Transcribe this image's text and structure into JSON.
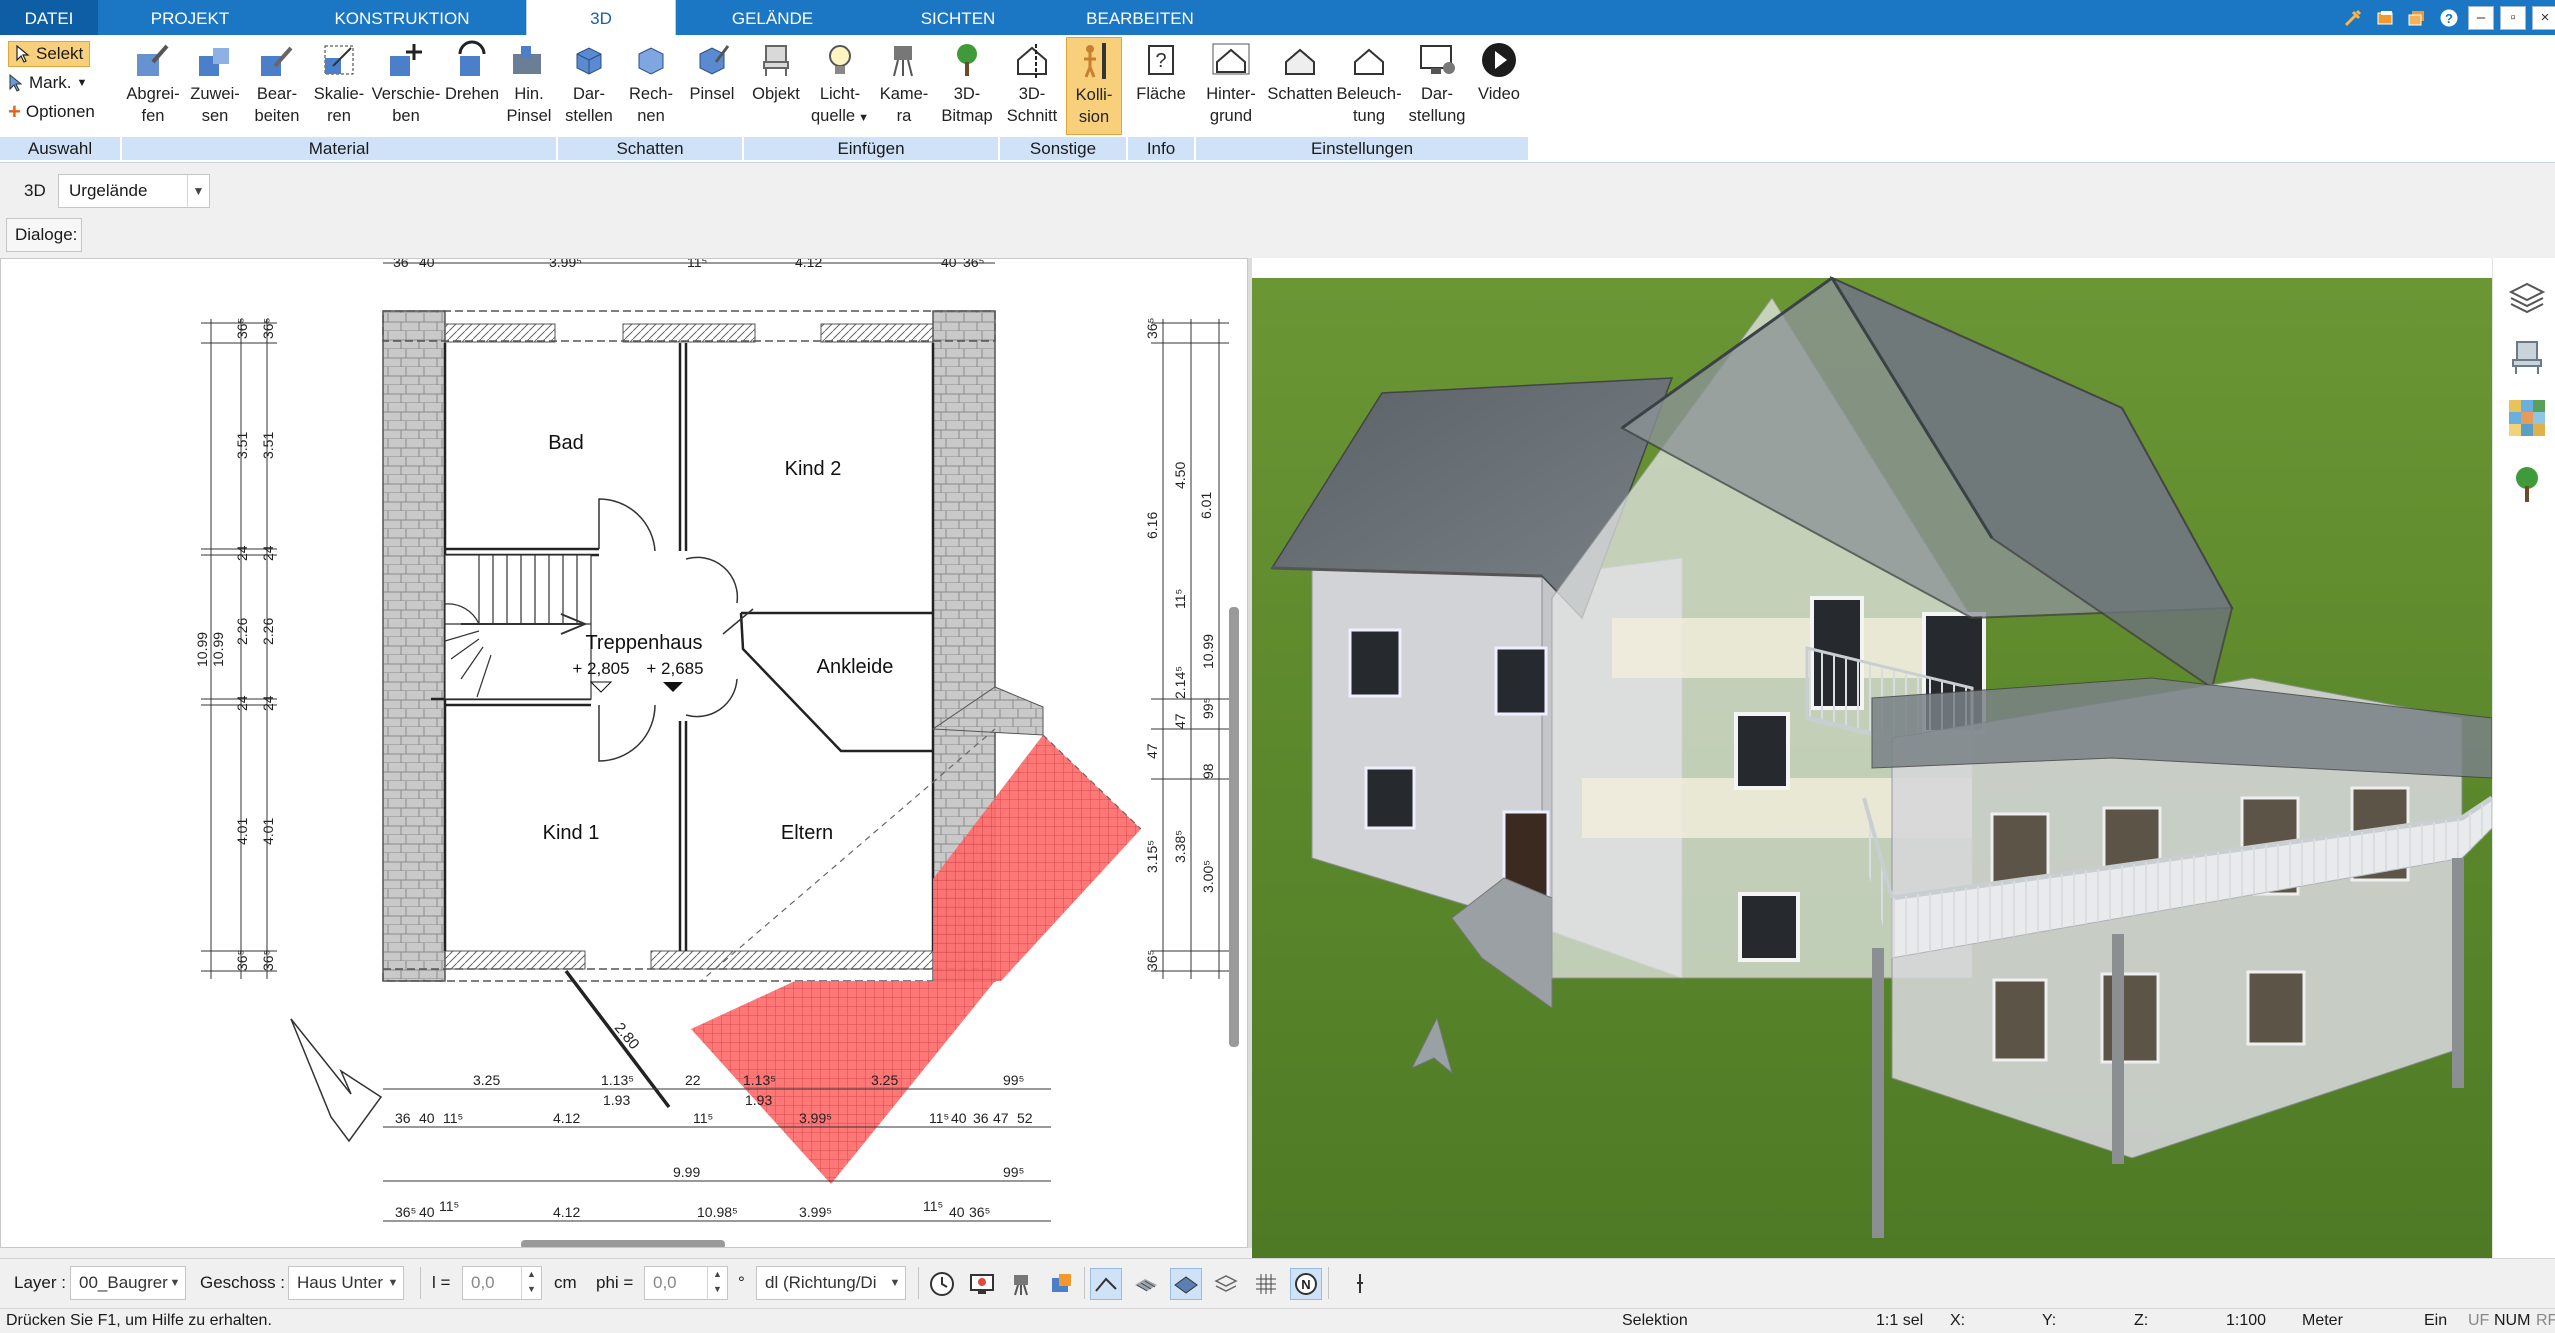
{
  "tabs": [
    {
      "label": "DATEI"
    },
    {
      "label": "PROJEKT"
    },
    {
      "label": "KONSTRUKTION"
    },
    {
      "label": "3D"
    },
    {
      "label": "GELÄNDE"
    },
    {
      "label": "SICHTEN"
    },
    {
      "label": "BEARBEITEN"
    }
  ],
  "ribbon": {
    "auswahl": {
      "label": "Auswahl",
      "selekt": "Selekt",
      "mark": "Mark.",
      "optionen": "Optionen"
    },
    "material": {
      "label": "Material",
      "buttons": [
        {
          "l1": "Abgrei-",
          "l2": "fen"
        },
        {
          "l1": "Zuwei-",
          "l2": "sen"
        },
        {
          "l1": "Bear-",
          "l2": "beiten"
        },
        {
          "l1": "Skalie-",
          "l2": "ren"
        },
        {
          "l1": "Verschie-",
          "l2": "ben"
        },
        {
          "l1": "Drehen",
          "l2": ""
        },
        {
          "l1": "Hin.",
          "l2": "Pinsel"
        }
      ]
    },
    "schatten": {
      "label": "Schatten",
      "buttons": [
        {
          "l1": "Dar-",
          "l2": "stellen"
        },
        {
          "l1": "Rech-",
          "l2": "nen"
        },
        {
          "l1": "Pinsel",
          "l2": ""
        }
      ]
    },
    "einfuegen": {
      "label": "Einfügen",
      "buttons": [
        {
          "l1": "Objekt",
          "l2": ""
        },
        {
          "l1": "Licht-",
          "l2": "quelle"
        },
        {
          "l1": "Kame-",
          "l2": "ra"
        },
        {
          "l1": "3D-",
          "l2": "Bitmap"
        }
      ]
    },
    "sonstige": {
      "label": "Sonstige",
      "buttons": [
        {
          "l1": "3D-",
          "l2": "Schnitt"
        },
        {
          "l1": "Kolli-",
          "l2": "sion"
        }
      ]
    },
    "info": {
      "label": "Info",
      "buttons": [
        {
          "l1": "Fläche",
          "l2": ""
        }
      ]
    },
    "einstellungen": {
      "label": "Einstellungen",
      "buttons": [
        {
          "l1": "Hinter-",
          "l2": "grund"
        },
        {
          "l1": "Schatten",
          "l2": ""
        },
        {
          "l1": "Beleuch-",
          "l2": "tung"
        },
        {
          "l1": "Dar-",
          "l2": "stellung"
        },
        {
          "l1": "Video",
          "l2": ""
        }
      ]
    }
  },
  "toolbar": {
    "mode_label": "3D",
    "terrain_select": "Urgelände",
    "dialoge_label": "Dialoge:"
  },
  "plan": {
    "rooms": {
      "bad": "Bad",
      "kind2": "Kind 2",
      "treppenhaus": "Treppenhaus",
      "level1": "+ 2,805",
      "level2": "+ 2,685",
      "ankleide": "Ankleide",
      "kind1": "Kind 1",
      "eltern": "Eltern"
    },
    "dims_top": [
      "36",
      "40",
      "3.99⁵",
      "11⁵",
      "4.12",
      "40",
      "36⁵"
    ],
    "dims_left_outer": [
      "36⁵",
      "3.51",
      "24",
      "2.26",
      "24",
      "4.01",
      "36⁵"
    ],
    "dims_left_inner": [
      "36⁵",
      "3.51",
      "24",
      "2.26",
      "24",
      "4.01",
      "36⁵"
    ],
    "dims_left_total": [
      "10.99",
      "10.99"
    ],
    "dims_right": [
      "36⁵",
      "6.16",
      "4.50",
      "6.01",
      "11⁵",
      "2.14⁵",
      "10.99",
      "99⁵",
      "47",
      "47",
      "98",
      "3.15⁵",
      "3.38⁵",
      "3.00⁵",
      "36⁵"
    ],
    "dims_bottom_row1": [
      "3.25",
      "1.13⁵",
      "1.93",
      "22",
      "1.13⁵",
      "1.93",
      "3.25",
      "99⁵"
    ],
    "dims_bottom_row2": [
      "36",
      "40",
      "11⁵",
      "4.12",
      "11⁵",
      "3.99⁵",
      "11⁵",
      "40",
      "36",
      "47",
      "52"
    ],
    "dims_bottom_row3": [
      "9.99",
      "99⁵"
    ],
    "dims_bottom_row4": [
      "36⁵",
      "40",
      "11⁵",
      "4.12",
      "10.98⁵",
      "3.99⁵",
      "11⁵",
      "40",
      "36⁵"
    ],
    "diag_dim": "2.80"
  },
  "bottombar": {
    "layer_label": "Layer :",
    "layer_value": "00_Baugrer",
    "geschoss_label": "Geschoss :",
    "geschoss_value": "Haus Unter",
    "l_label": "l =",
    "l_value": "0,0",
    "l_unit": "cm",
    "phi_label": "phi =",
    "phi_value": "0,0",
    "phi_unit": "°",
    "dl_value": "dl (Richtung/Di"
  },
  "status": {
    "help": "Drücken Sie F1, um Hilfe zu erhalten.",
    "mode": "Selektion",
    "scale_sel": "1:1 sel",
    "x": "X:",
    "y": "Y:",
    "z": "Z:",
    "scale": "1:100",
    "unit": "Meter",
    "ein": "Ein",
    "uf": "UF",
    "num": "NUM",
    "rf": "RF"
  },
  "colors": {
    "tab_bar": "#1b76c4",
    "group_label": "#cfe2f7",
    "selected_button": "#f8d07c",
    "grass": "#5b8a2c",
    "roof": "#6b7378",
    "hatch_red": "#ff5a5a"
  }
}
